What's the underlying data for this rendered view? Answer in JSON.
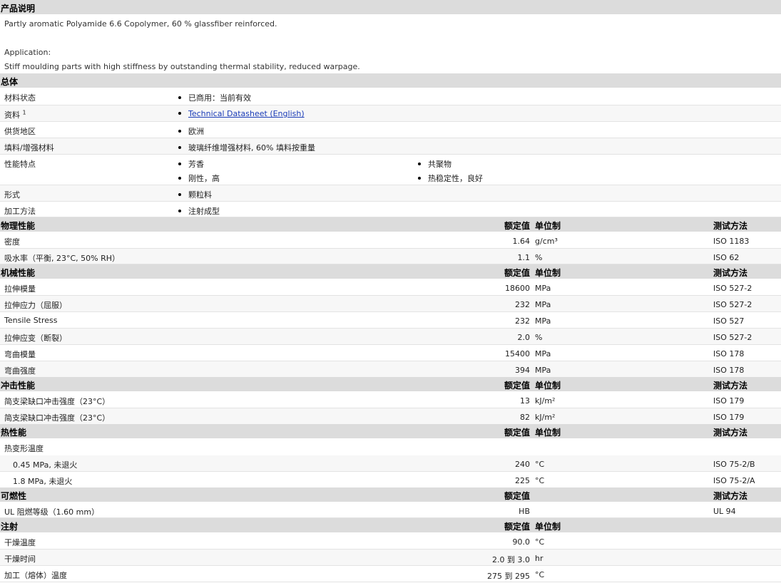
{
  "product": {
    "title": "产品说明",
    "description": "Partly aromatic Polyamide 6.6 Copolymer, 60 % glassfiber reinforced.",
    "application_label": "Application:",
    "application_text": "Stiff moulding parts with high stiffness by outstanding thermal stability, reduced warpage."
  },
  "general": {
    "title": "总体",
    "rows": [
      {
        "label": "材料状态",
        "value": "已商用：当前有效"
      },
      {
        "label": "资料",
        "sup": "1",
        "value": "Technical Datasheet (English)"
      },
      {
        "label": "供货地区",
        "value": "欧洲"
      },
      {
        "label": "填料/增强材料",
        "value": "玻璃纤维增强材料, 60% 填料按重量"
      },
      {
        "label": "性能特点",
        "values": [
          "芳香",
          "共聚物",
          "刚性，高",
          "热稳定性，良好"
        ]
      },
      {
        "label": "形式",
        "value": "颗粒料"
      },
      {
        "label": "加工方法",
        "value": "注射成型"
      }
    ]
  },
  "headers": {
    "nominal": "额定值",
    "unit": "单位制",
    "test": "测试方法"
  },
  "physical": {
    "title": "物理性能",
    "rows": [
      {
        "label": "密度",
        "value": "1.64",
        "unit": "g/cm³",
        "test": "ISO 1183"
      },
      {
        "label": "吸水率（平衡, 23°C, 50% RH）",
        "value": "1.1",
        "unit": "%",
        "test": "ISO 62"
      }
    ]
  },
  "mechanical": {
    "title": "机械性能",
    "rows": [
      {
        "label": "拉伸模量",
        "value": "18600",
        "unit": "MPa",
        "test": "ISO 527-2"
      },
      {
        "label": "拉伸应力（屈服）",
        "value": "232",
        "unit": "MPa",
        "test": "ISO 527-2"
      },
      {
        "label": "Tensile Stress",
        "value": "232",
        "unit": "MPa",
        "test": "ISO 527"
      },
      {
        "label": "拉伸应变（断裂）",
        "value": "2.0",
        "unit": "%",
        "test": "ISO 527-2"
      },
      {
        "label": "弯曲模量",
        "value": "15400",
        "unit": "MPa",
        "test": "ISO 178"
      },
      {
        "label": "弯曲强度",
        "value": "394",
        "unit": "MPa",
        "test": "ISO 178"
      }
    ]
  },
  "impact": {
    "title": "冲击性能",
    "rows": [
      {
        "label": "简支梁缺口冲击强度（23°C）",
        "value": "13",
        "unit": "kJ/m²",
        "test": "ISO 179"
      },
      {
        "label": "简支梁缺口冲击强度（23°C）",
        "value": "82",
        "unit": "kJ/m²",
        "test": "ISO 179"
      }
    ]
  },
  "thermal": {
    "title": "热性能",
    "group_label": "热变形温度",
    "rows": [
      {
        "label": "0.45 MPa, 未退火",
        "value": "240",
        "unit": "°C",
        "test": "ISO 75-2/B"
      },
      {
        "label": "1.8 MPa, 未退火",
        "value": "225",
        "unit": "°C",
        "test": "ISO 75-2/A"
      }
    ]
  },
  "flammability": {
    "title": "可燃性",
    "rows": [
      {
        "label": "UL 阻燃等级（1.60 mm）",
        "value": "HB",
        "test": "UL 94"
      }
    ]
  },
  "injection": {
    "title": "注射",
    "rows": [
      {
        "label": "干燥温度",
        "value": "90.0",
        "unit": "°C"
      },
      {
        "label": "干燥时间",
        "value_from": "2.0",
        "to": "到",
        "value_to": "3.0",
        "unit": "hr"
      },
      {
        "label": "加工（熔体）温度",
        "value_from": "275",
        "to": "到",
        "value_to": "295",
        "unit": "°C"
      }
    ]
  }
}
